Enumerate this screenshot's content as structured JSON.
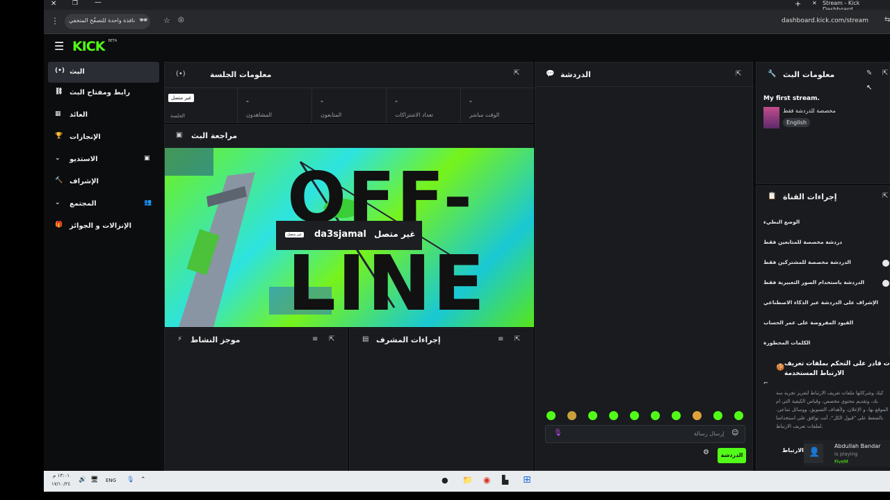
{
  "browser": {
    "tab_title": "Stream - Kick Dashboard",
    "url": "dashboard.kick.com/stream",
    "incognito_label": "نافذة واحدة للتصفّح المتخفي"
  },
  "brand": {
    "logo": "KICK",
    "beta": "BETA"
  },
  "sidebar": {
    "items": [
      {
        "label": "البث",
        "icon": "broadcast-icon"
      },
      {
        "label": "رابط ومفتاح البث",
        "icon": "link-icon"
      },
      {
        "label": "العائد",
        "icon": "wallet-icon"
      },
      {
        "label": "الإنجازات",
        "icon": "trophy-icon"
      },
      {
        "label": "الاستديو",
        "icon": "studio-icon"
      },
      {
        "label": "الإشراف",
        "icon": "hammer-icon"
      },
      {
        "label": "المجتمع",
        "icon": "community-icon"
      },
      {
        "label": "الإنزالات و الجوائز",
        "icon": "gift-icon"
      }
    ]
  },
  "session": {
    "title": "معلومات الجلسة",
    "status_badge": "غير متصل",
    "session_label": "الجلسة",
    "stats": [
      {
        "value": "-",
        "label": "المشاهدون"
      },
      {
        "value": "-",
        "label": "المتابعون"
      },
      {
        "value": "-",
        "label": "تعداد الاشتراكات"
      },
      {
        "value": "-",
        "label": "الوقت مباشر"
      }
    ]
  },
  "preview": {
    "title": "مراجعة البث",
    "offline_text_1": "OFF-",
    "offline_text_2": "LINE",
    "status_text": "غير متصل",
    "channel": "da3sjamal",
    "badge": "غير متصل"
  },
  "activity": {
    "title": "موجز النشاط"
  },
  "mod_actions": {
    "title": "إجراءات المشرف"
  },
  "chat": {
    "title": "الدردشة",
    "placeholder": "إرسال رسالة",
    "send_label": "الدردشة"
  },
  "stream_info": {
    "title": "معلومات البث",
    "stream_title": "My first stream.",
    "category": "مخصصة للدردشة فقط",
    "language": "English"
  },
  "channel_actions": {
    "title": "إجراءات القناة",
    "settings": [
      "الوضع البطيء",
      "دردشة مخصصة للمتابعين فقط",
      "الدردشة مخصصة للمشتركين فقط",
      "الدردشة باستخدام الصور التعبيرية فقط",
      "الإشراف على الدردشة عبر الذكاء الاصطناعي",
      "القيود المفروضة على عمر الحساب",
      "الكلمات المحظورة"
    ]
  },
  "cookie": {
    "heading": "ت قادر على التحكم بملفات تعريف الارتباط المستخدمة",
    "body": "كيك وشركائها ملفات تعريف الارتباط لتعزيز تجربة سة بك، وتقديم محتوى مخصص، وقياس الكيفية التي ام الموقع بها، و الإعلان، ولأهداف التسويق، ووسائل تماعي. بالضغط على \"قبول الكل\"، أنت توافق على استخدامنا لملفات تعريف الارتباط.",
    "footer": "الارتباط"
  },
  "notification": {
    "name": "Abdullah Bandar",
    "status": "is playing",
    "game": "FiveM"
  },
  "taskbar": {
    "time": "١٣:٠١ م",
    "date": "١٧/١٠/٢٤",
    "lang": "ENG"
  },
  "colors": {
    "accent": "#53fc18",
    "panel": "#191b1f"
  }
}
